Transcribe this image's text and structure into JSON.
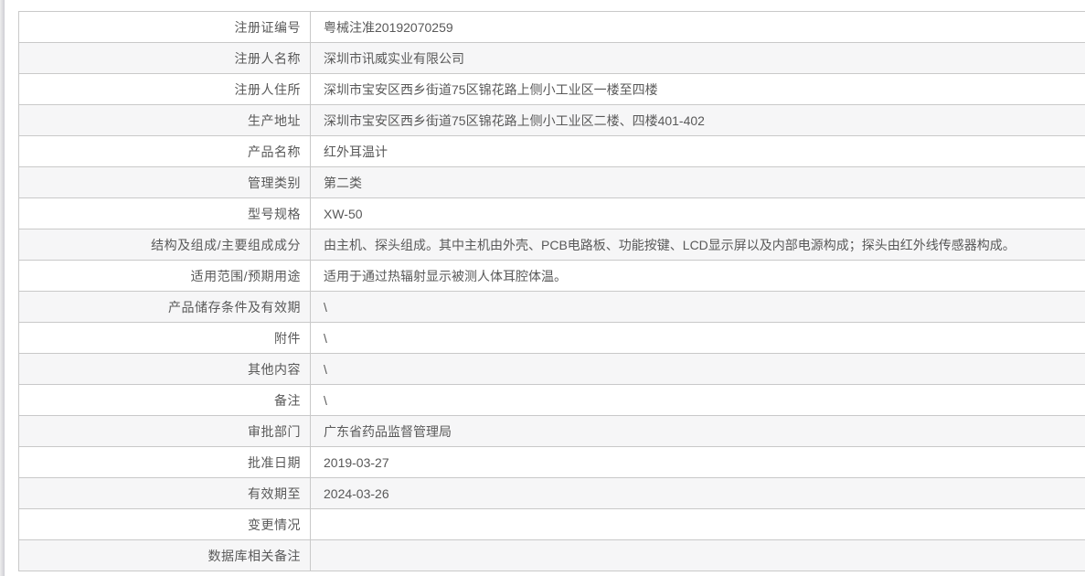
{
  "table": {
    "rows": [
      {
        "label": "注册证编号",
        "value": "粤械注准20192070259"
      },
      {
        "label": "注册人名称",
        "value": "深圳市讯威实业有限公司"
      },
      {
        "label": "注册人住所",
        "value": "深圳市宝安区西乡街道75区锦花路上侧小工业区一楼至四楼"
      },
      {
        "label": "生产地址",
        "value": "深圳市宝安区西乡街道75区锦花路上侧小工业区二楼、四楼401-402"
      },
      {
        "label": "产品名称",
        "value": "红外耳温计"
      },
      {
        "label": "管理类别",
        "value": "第二类"
      },
      {
        "label": "型号规格",
        "value": "XW-50"
      },
      {
        "label": "结构及组成/主要组成成分",
        "value": "由主机、探头组成。其中主机由外壳、PCB电路板、功能按键、LCD显示屏以及内部电源构成；探头由红外线传感器构成。"
      },
      {
        "label": "适用范围/预期用途",
        "value": "适用于通过热辐射显示被测人体耳腔体温。"
      },
      {
        "label": "产品储存条件及有效期",
        "value": "\\"
      },
      {
        "label": "附件",
        "value": "\\"
      },
      {
        "label": "其他内容",
        "value": "\\"
      },
      {
        "label": "备注",
        "value": "\\"
      },
      {
        "label": "审批部门",
        "value": "广东省药品监督管理局"
      },
      {
        "label": "批准日期",
        "value": "2019-03-27"
      },
      {
        "label": "有效期至",
        "value": "2024-03-26"
      },
      {
        "label": "变更情况",
        "value": ""
      },
      {
        "label": "数据库相关备注",
        "value": ""
      }
    ]
  },
  "colors": {
    "row_alt_bg": "#f6f6f7",
    "border": "#c9c9c9",
    "text": "#595959"
  }
}
